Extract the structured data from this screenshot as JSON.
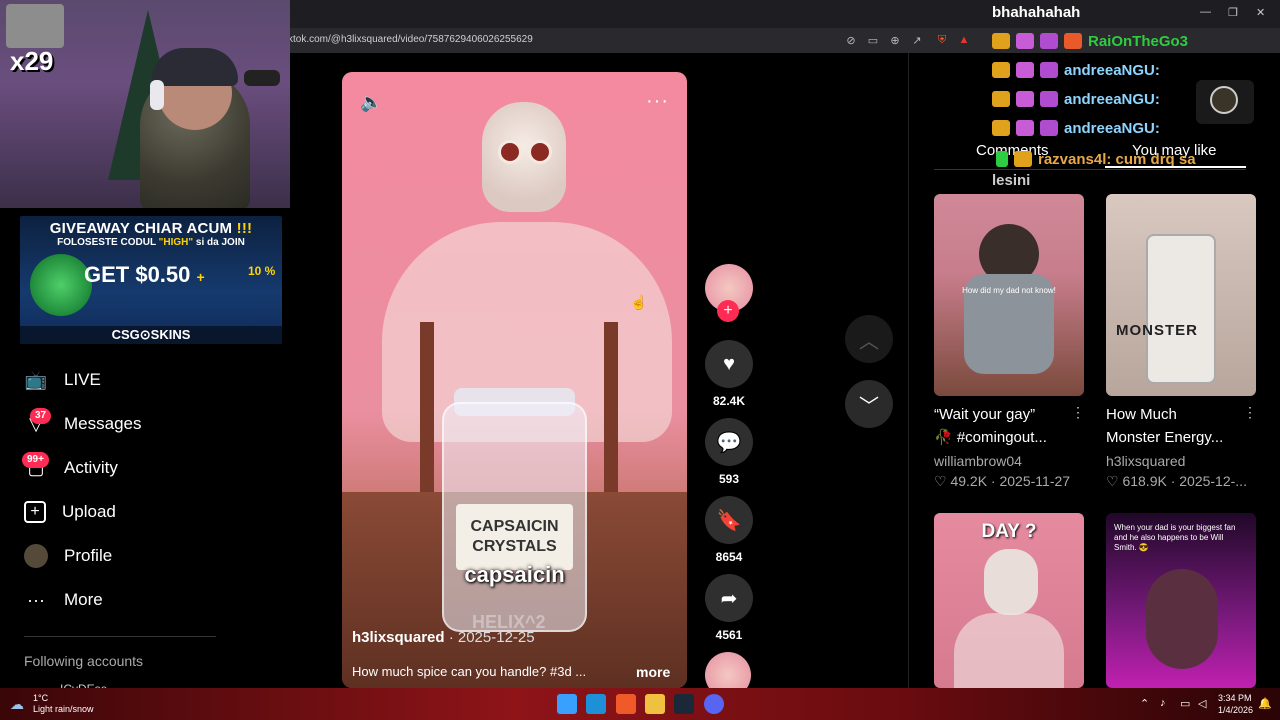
{
  "browser": {
    "url": "ktok.com/@h3lixsquared/video/7587629406026255629"
  },
  "stream": {
    "title": "bhahahahah",
    "combo": "x29"
  },
  "giveaway": {
    "title_a": "GIVEAWAY CHIAR ACUM",
    "title_b": " !!!",
    "sub_a": "FOLOSESTE CODUL ",
    "sub_code": "\"HIGH\"",
    "sub_b": " si da JOIN",
    "get": "GET $0.50",
    "plus": "+",
    "pct": "10 %",
    "brand": "CSG⊙SKINS"
  },
  "sidebar": {
    "items": [
      {
        "label": "LIVE",
        "icon": "live-tv-icon"
      },
      {
        "label": "Messages",
        "icon": "messages-icon",
        "badge": "37"
      },
      {
        "label": "Activity",
        "icon": "activity-icon",
        "badge": "99+"
      },
      {
        "label": "Upload",
        "icon": "upload-icon"
      },
      {
        "label": "Profile",
        "icon": "profile-avatar"
      },
      {
        "label": "More",
        "icon": "more-dots-icon"
      }
    ],
    "following_title": "Following accounts",
    "following_partial": "ICyDEse"
  },
  "video": {
    "jar_label_1": "CAPSAICIN",
    "jar_label_2": "CRYSTALS",
    "caption": "capsaicin",
    "watermark": "HELIX^2",
    "author": "h3lixsquared",
    "date": " · 2025-12-25",
    "description": "How much spice can you handle? #3d ...",
    "more": "more"
  },
  "actions": {
    "likes": "82.4K",
    "comments": "593",
    "saves": "8654",
    "shares": "4561"
  },
  "chat": [
    {
      "name": "RaiOnTheGo3",
      "text": ""
    },
    {
      "name": "andreeaNGU:",
      "text": ""
    },
    {
      "name": "andreeaNGU:",
      "text": ""
    },
    {
      "name": "andreeaNGU:",
      "text": ""
    },
    {
      "name": "razvans4l:",
      "text": "cum drq sa"
    },
    {
      "name": "",
      "text": "lesini"
    }
  ],
  "right_panel": {
    "tab_comments": "Comments",
    "tab_you_may_like": "You may like",
    "cards": [
      {
        "title": "“Wait your gay”",
        "title2": "🥀 #comingout...",
        "author": "williambrow04",
        "likes": "♡ 49.2K",
        "date": " · 2025-11-27",
        "thumb_text": "How did my dad not know!"
      },
      {
        "title": "How Much",
        "title2": "Monster Energy...",
        "author": "h3lixsquared",
        "likes": "♡ 618.9K",
        "date": " · 2025-12-...",
        "thumb_text": "MONSTER"
      },
      {
        "thumb_text": "DAY ?"
      },
      {
        "thumb_text": "When your dad is your biggest fan and he also happens to be Will Smith. 😎"
      }
    ]
  },
  "taskbar": {
    "temp": "1°C",
    "weather": "Light rain/snow",
    "time": "3:34 PM",
    "date": "1/4/2026"
  },
  "colors": {
    "accent": "#fe2c55",
    "chat_green": "#2ecc40",
    "chat_blue": "#8dd5ff"
  }
}
